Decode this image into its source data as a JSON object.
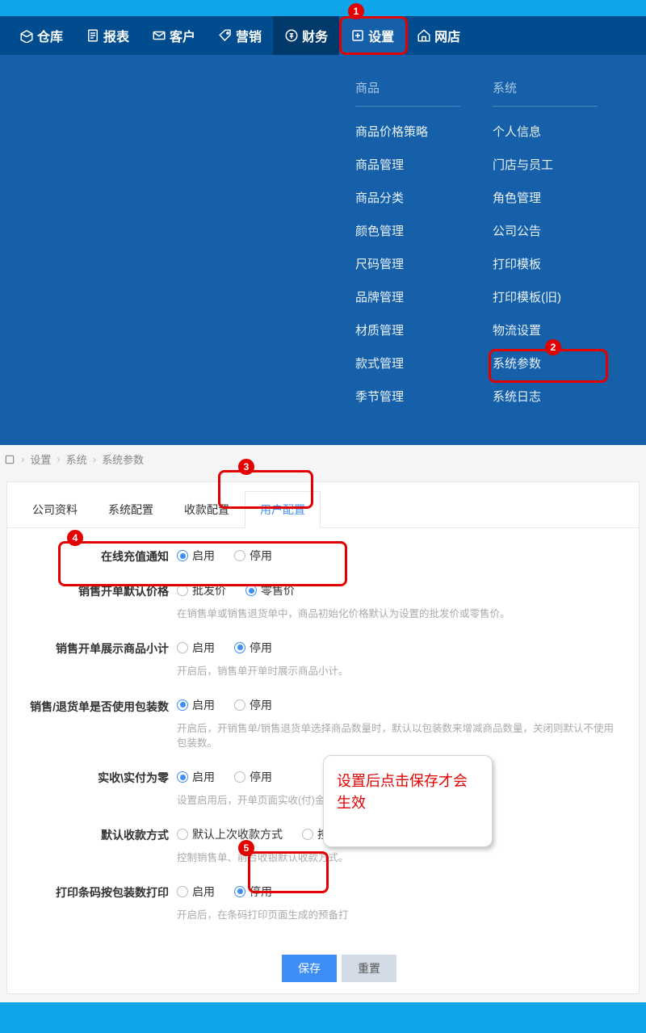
{
  "nav": {
    "items": [
      {
        "label": "仓库"
      },
      {
        "label": "报表"
      },
      {
        "label": "客户"
      },
      {
        "label": "营销"
      },
      {
        "label": "财务"
      },
      {
        "label": "设置"
      },
      {
        "label": "网店"
      }
    ]
  },
  "mega": {
    "col1": {
      "title": "商品",
      "items": [
        "商品价格策略",
        "商品管理",
        "商品分类",
        "颜色管理",
        "尺码管理",
        "品牌管理",
        "材质管理",
        "款式管理",
        "季节管理"
      ]
    },
    "col2": {
      "title": "系统",
      "items": [
        "个人信息",
        "门店与员工",
        "角色管理",
        "公司公告",
        "打印模板",
        "打印模板(旧)",
        "物流设置",
        "系统参数",
        "系统日志"
      ]
    }
  },
  "breadcrumb": {
    "a": "设置",
    "b": "系统",
    "c": "系统参数"
  },
  "tabs": {
    "t1": "公司资料",
    "t2": "系统配置",
    "t3": "收款配置",
    "t4": "用户配置"
  },
  "form": {
    "r1": {
      "label": "在线充值通知",
      "o1": "启用",
      "o2": "停用"
    },
    "r2": {
      "label": "销售开单默认价格",
      "o1": "批发价",
      "o2": "零售价",
      "hint": "在销售单或销售退货单中，商品初始化价格默认为设置的批发价或零售价。"
    },
    "r3": {
      "label": "销售开单展示商品小计",
      "o1": "启用",
      "o2": "停用",
      "hint": "开启后，销售单开单时展示商品小计。"
    },
    "r4": {
      "label": "销售/退货单是否使用包装数",
      "o1": "启用",
      "o2": "停用",
      "hint": "开启后，开销售单/销售退货单选择商品数量时，默认以包装数来增减商品数量，关闭则默认不使用包装数。"
    },
    "r5": {
      "label": "实收\\实付为零",
      "o1": "启用",
      "o2": "停用",
      "hint": "设置启用后，开单页面实收(付)金额将默认为零。"
    },
    "r6": {
      "label": "默认收款方式",
      "o1": "默认上次收款方式",
      "o2": "按",
      "hint": "控制销售单、前台收银默认收款方式。"
    },
    "r7": {
      "label": "打印条码按包装数打印",
      "o1": "启用",
      "o2": "停用",
      "hint": "开启后，在条码打印页面生成的预备打"
    }
  },
  "buttons": {
    "save": "保存",
    "reset": "重置"
  },
  "callout": {
    "text": "设置后点击保存才会生效"
  },
  "anno": {
    "n1": "1",
    "n2": "2",
    "n3": "3",
    "n4": "4",
    "n5": "5"
  }
}
